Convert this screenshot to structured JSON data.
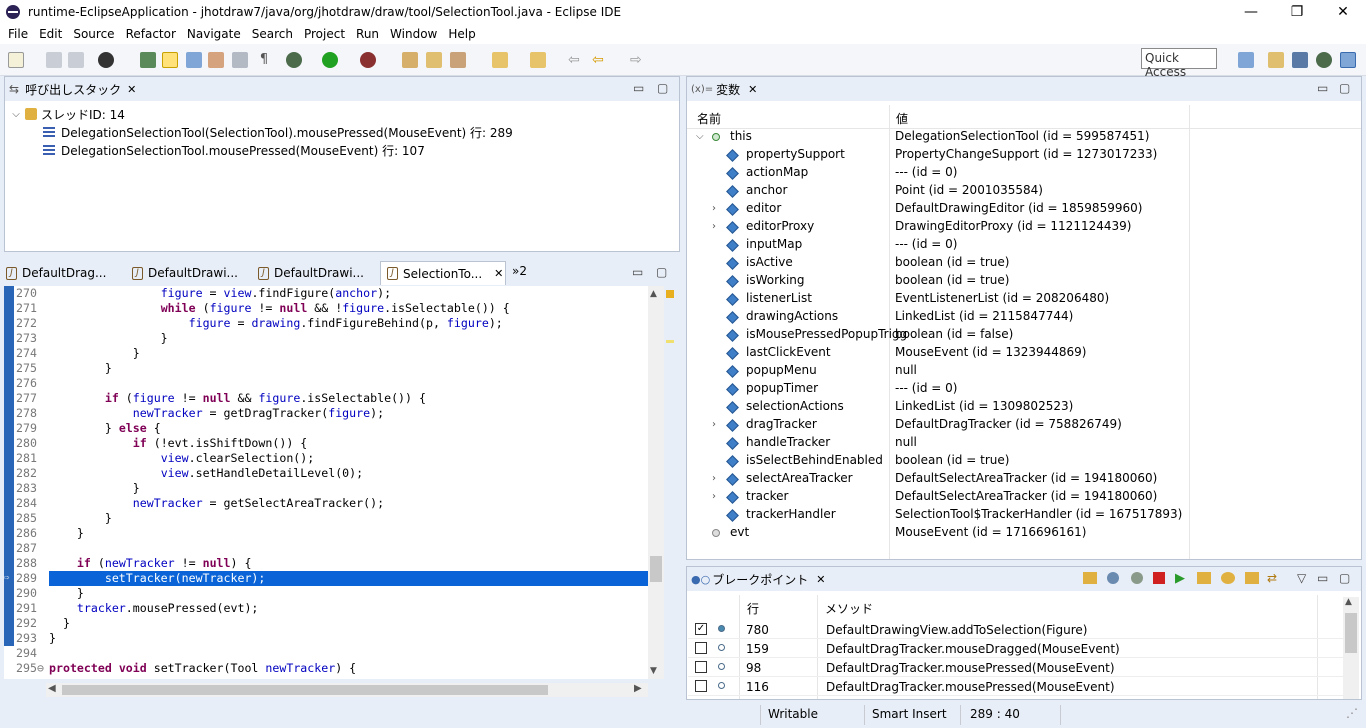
{
  "window": {
    "title": "runtime-EclipseApplication - jhotdraw7/java/org/jhotdraw/draw/tool/SelectionTool.java - Eclipse IDE",
    "minimize": "—",
    "restore": "❐",
    "close": "✕"
  },
  "menu": [
    "File",
    "Edit",
    "Source",
    "Refactor",
    "Navigate",
    "Search",
    "Project",
    "Run",
    "Window",
    "Help"
  ],
  "toolbar": {
    "quick_access": "Quick Access"
  },
  "callstack": {
    "tab": "呼び出しスタック",
    "thread": "スレッドID: 14",
    "frames": [
      "DelegationSelectionTool(SelectionTool).mousePressed(MouseEvent) 行: 289",
      "DelegationSelectionTool.mousePressed(MouseEvent) 行: 107"
    ]
  },
  "editor": {
    "tabs": [
      "DefaultDrag...",
      "DefaultDrawi...",
      "DefaultDrawi...",
      "SelectionTo..."
    ],
    "overflow": "»2",
    "lines": [
      {
        "n": "270",
        "code": "                figure = view.findFigure(anchor);"
      },
      {
        "n": "271",
        "code": "                while (figure != null && !figure.isSelectable()) {"
      },
      {
        "n": "272",
        "code": "                    figure = drawing.findFigureBehind(p, figure);"
      },
      {
        "n": "273",
        "code": "                }"
      },
      {
        "n": "274",
        "code": "            }"
      },
      {
        "n": "275",
        "code": "        }"
      },
      {
        "n": "276",
        "code": ""
      },
      {
        "n": "277",
        "code": "        if (figure != null && figure.isSelectable()) {"
      },
      {
        "n": "278",
        "code": "            newTracker = getDragTracker(figure);"
      },
      {
        "n": "279",
        "code": "        } else {"
      },
      {
        "n": "280",
        "code": "            if (!evt.isShiftDown()) {"
      },
      {
        "n": "281",
        "code": "                view.clearSelection();"
      },
      {
        "n": "282",
        "code": "                view.setHandleDetailLevel(0);"
      },
      {
        "n": "283",
        "code": "            }"
      },
      {
        "n": "284",
        "code": "            newTracker = getSelectAreaTracker();"
      },
      {
        "n": "285",
        "code": "        }"
      },
      {
        "n": "286",
        "code": "    }"
      },
      {
        "n": "287",
        "code": ""
      },
      {
        "n": "288",
        "code": "    if (newTracker != null) {"
      },
      {
        "n": "289",
        "code": "        setTracker(newTracker);"
      },
      {
        "n": "290",
        "code": "    }"
      },
      {
        "n": "291",
        "code": "    tracker.mousePressed(evt);"
      },
      {
        "n": "292",
        "code": "  }"
      },
      {
        "n": "293",
        "code": "}"
      },
      {
        "n": "294",
        "code": ""
      },
      {
        "n": "295⊖",
        "code": "protected void setTracker(Tool newTracker) {"
      }
    ]
  },
  "variables": {
    "tab": "変数",
    "col_name": "名前",
    "col_value": "値",
    "rows": [
      {
        "name": "this",
        "value": "DelegationSelectionTool (id = 599587451)",
        "expand": "open",
        "kind": "dot",
        "depth": 0
      },
      {
        "name": "propertySupport",
        "value": "PropertyChangeSupport (id = 1273017233)",
        "expand": "",
        "kind": "diamond",
        "depth": 1
      },
      {
        "name": "actionMap",
        "value": "--- (id = 0)",
        "expand": "",
        "kind": "diamond",
        "depth": 1
      },
      {
        "name": "anchor",
        "value": "Point (id = 2001035584)",
        "expand": "",
        "kind": "diamond",
        "depth": 1
      },
      {
        "name": "editor",
        "value": "DefaultDrawingEditor (id = 1859859960)",
        "expand": "closed",
        "kind": "diamond",
        "depth": 1
      },
      {
        "name": "editorProxy",
        "value": "DrawingEditorProxy (id = 1121124439)",
        "expand": "closed",
        "kind": "diamond",
        "depth": 1
      },
      {
        "name": "inputMap",
        "value": "--- (id = 0)",
        "expand": "",
        "kind": "diamond",
        "depth": 1
      },
      {
        "name": "isActive",
        "value": "boolean (id = true)",
        "expand": "",
        "kind": "diamond",
        "depth": 1
      },
      {
        "name": "isWorking",
        "value": "boolean (id = true)",
        "expand": "",
        "kind": "diamond",
        "depth": 1
      },
      {
        "name": "listenerList",
        "value": "EventListenerList (id = 208206480)",
        "expand": "",
        "kind": "diamond",
        "depth": 1
      },
      {
        "name": "drawingActions",
        "value": "LinkedList (id = 2115847744)",
        "expand": "",
        "kind": "diamond",
        "depth": 1
      },
      {
        "name": "isMousePressedPopupTrigg",
        "value": "boolean (id = false)",
        "expand": "",
        "kind": "diamond",
        "depth": 1
      },
      {
        "name": "lastClickEvent",
        "value": "MouseEvent (id = 1323944869)",
        "expand": "",
        "kind": "diamond",
        "depth": 1
      },
      {
        "name": "popupMenu",
        "value": "null",
        "expand": "",
        "kind": "diamond",
        "depth": 1
      },
      {
        "name": "popupTimer",
        "value": "--- (id = 0)",
        "expand": "",
        "kind": "diamond",
        "depth": 1
      },
      {
        "name": "selectionActions",
        "value": "LinkedList (id = 1309802523)",
        "expand": "",
        "kind": "diamond",
        "depth": 1
      },
      {
        "name": "dragTracker",
        "value": "DefaultDragTracker (id = 758826749)",
        "expand": "closed",
        "kind": "diamond",
        "depth": 1
      },
      {
        "name": "handleTracker",
        "value": "null",
        "expand": "",
        "kind": "diamond",
        "depth": 1
      },
      {
        "name": "isSelectBehindEnabled",
        "value": "boolean (id = true)",
        "expand": "",
        "kind": "diamond",
        "depth": 1
      },
      {
        "name": "selectAreaTracker",
        "value": "DefaultSelectAreaTracker (id = 194180060)",
        "expand": "closed",
        "kind": "diamond",
        "depth": 1
      },
      {
        "name": "tracker",
        "value": "DefaultSelectAreaTracker (id = 194180060)",
        "expand": "closed",
        "kind": "diamond",
        "depth": 1
      },
      {
        "name": "trackerHandler",
        "value": "SelectionTool$TrackerHandler (id = 167517893)",
        "expand": "",
        "kind": "diamond",
        "depth": 1
      },
      {
        "name": "evt",
        "value": "MouseEvent (id = 1716696161)",
        "expand": "",
        "kind": "local",
        "depth": 0
      }
    ]
  },
  "breakpoints": {
    "tab": "ブレークポイント",
    "col_line": "行",
    "col_method": "メソッド",
    "rows": [
      {
        "checked": true,
        "line": "780",
        "method": "DefaultDrawingView.addToSelection(Figure)"
      },
      {
        "checked": false,
        "line": "159",
        "method": "DefaultDragTracker.mouseDragged(MouseEvent)"
      },
      {
        "checked": false,
        "line": "98",
        "method": "DefaultDragTracker.mousePressed(MouseEvent)"
      },
      {
        "checked": false,
        "line": "116",
        "method": "DefaultDragTracker.mousePressed(MouseEvent)"
      }
    ]
  },
  "status": {
    "writable": "Writable",
    "insert_mode": "Smart Insert",
    "position": "289 : 40"
  },
  "colors": {
    "selection": "#0a64d8",
    "keyword": "#7f0055",
    "field": "#0000c0",
    "debug_gutter": "#2966b8"
  }
}
